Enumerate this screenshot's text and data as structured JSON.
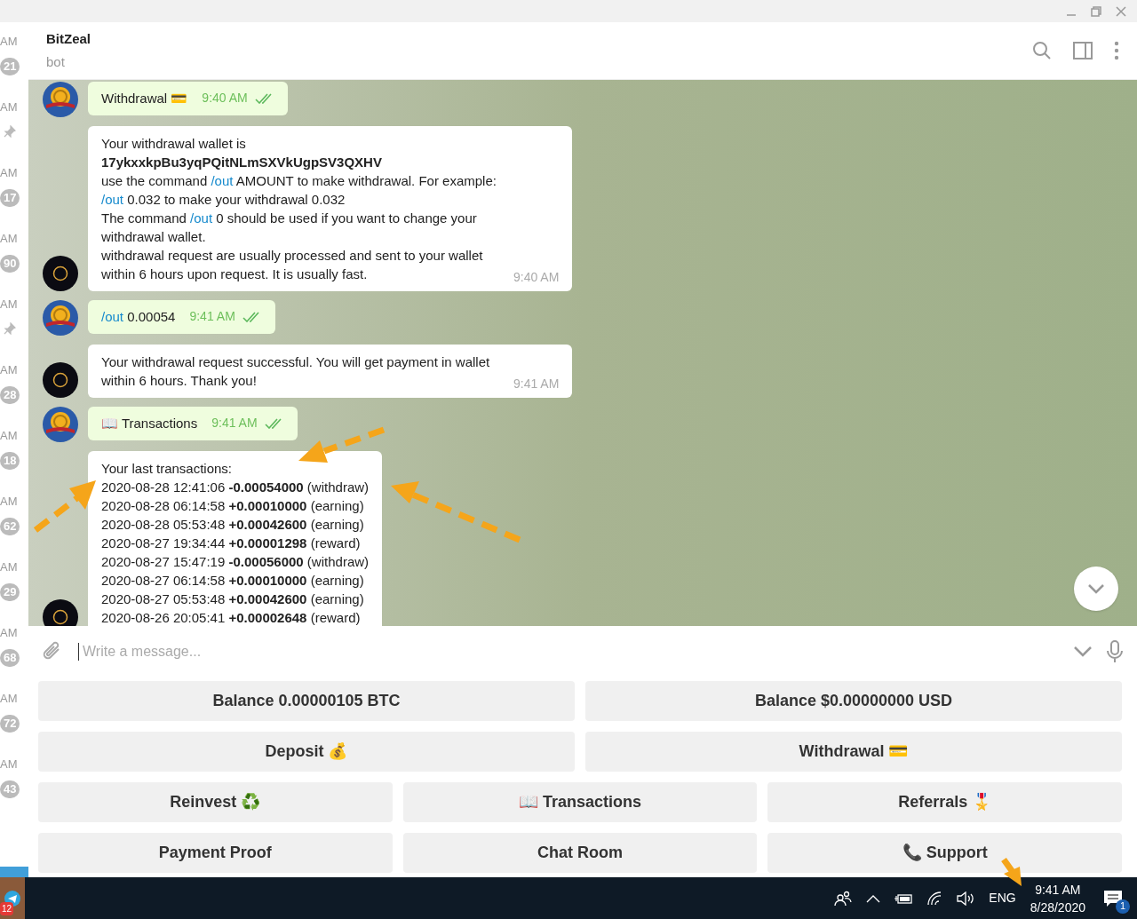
{
  "sidebar": {
    "items": [
      {
        "time": "AM",
        "badge": "21",
        "pinned": false
      },
      {
        "time": "AM",
        "pinned": true
      },
      {
        "time": "AM",
        "badge": "17",
        "pinned": false
      },
      {
        "time": "AM",
        "badge": "90",
        "pinned": false
      },
      {
        "time": "AM",
        "pinned": true
      },
      {
        "time": "AM",
        "badge": "28",
        "pinned": false
      },
      {
        "time": "AM",
        "badge": "18",
        "pinned": false
      },
      {
        "time": "AM",
        "badge": "62",
        "pinned": false
      },
      {
        "time": "AM",
        "badge": "29",
        "pinned": false
      },
      {
        "time": "AM",
        "badge": "68",
        "pinned": false
      },
      {
        "time": "AM",
        "badge": "72",
        "pinned": false
      },
      {
        "time": "AM",
        "badge": "43",
        "pinned": false
      }
    ]
  },
  "header": {
    "title": "BitZeal",
    "subtitle": "bot"
  },
  "messages": [
    {
      "kind": "outgoing",
      "time": "9:40 AM",
      "read": true,
      "lines": [
        [
          {
            "kind": "text",
            "t": "Withdrawal 💳"
          }
        ]
      ]
    },
    {
      "kind": "incoming",
      "time": "9:40 AM",
      "lines": [
        [
          {
            "kind": "text",
            "t": "Your withdrawal wallet is"
          }
        ],
        [
          {
            "kind": "bold",
            "t": "17ykxxkpBu3yqPQitNLmSXVkUgpSV3QXHV"
          }
        ],
        [
          {
            "kind": "text",
            "t": "use the command "
          },
          {
            "kind": "command",
            "t": "/out"
          },
          {
            "kind": "text",
            "t": " AMOUNT to make withdrawal. For example:"
          }
        ],
        [
          {
            "kind": "command",
            "t": "/out"
          },
          {
            "kind": "text",
            "t": " 0.032 to make your withdrawal 0.032"
          }
        ],
        [
          {
            "kind": "text",
            "t": "The command "
          },
          {
            "kind": "command",
            "t": "/out"
          },
          {
            "kind": "text",
            "t": " 0 should be used if you want to change your withdrawal wallet."
          }
        ],
        [
          {
            "kind": "text",
            "t": "withdrawal request are usually processed and sent to your wallet within 6 hours upon request. It is usually fast."
          }
        ]
      ]
    },
    {
      "kind": "outgoing",
      "time": "9:41 AM",
      "read": true,
      "lines": [
        [
          {
            "kind": "command",
            "t": "/out"
          },
          {
            "kind": "text",
            "t": " 0.00054"
          }
        ]
      ]
    },
    {
      "kind": "incoming",
      "time": "9:41 AM",
      "lines": [
        [
          {
            "kind": "text",
            "t": "Your withdrawal request successful. You will get payment in wallet within 6 hours. Thank you!"
          }
        ]
      ]
    },
    {
      "kind": "outgoing",
      "time": "9:41 AM",
      "read": true,
      "lines": [
        [
          {
            "kind": "text",
            "t": "📖 Transactions"
          }
        ]
      ]
    },
    {
      "kind": "incoming",
      "lines": [
        [
          {
            "kind": "text",
            "t": "Your last transactions:"
          }
        ],
        [
          {
            "kind": "text",
            "t": "2020-08-28 12:41:06 "
          },
          {
            "kind": "bold",
            "t": "-0.00054000"
          },
          {
            "kind": "text",
            "t": " (withdraw)"
          }
        ],
        [
          {
            "kind": "text",
            "t": "2020-08-28 06:14:58 "
          },
          {
            "kind": "bold",
            "t": "+0.00010000"
          },
          {
            "kind": "text",
            "t": " (earning)"
          }
        ],
        [
          {
            "kind": "text",
            "t": "2020-08-28 05:53:48 "
          },
          {
            "kind": "bold",
            "t": "+0.00042600"
          },
          {
            "kind": "text",
            "t": " (earning)"
          }
        ],
        [
          {
            "kind": "text",
            "t": "2020-08-27 19:34:44 "
          },
          {
            "kind": "bold",
            "t": "+0.00001298"
          },
          {
            "kind": "text",
            "t": " (reward)"
          }
        ],
        [
          {
            "kind": "text",
            "t": "2020-08-27 15:47:19 "
          },
          {
            "kind": "bold",
            "t": "-0.00056000"
          },
          {
            "kind": "text",
            "t": " (withdraw)"
          }
        ],
        [
          {
            "kind": "text",
            "t": "2020-08-27 06:14:58 "
          },
          {
            "kind": "bold",
            "t": "+0.00010000"
          },
          {
            "kind": "text",
            "t": " (earning)"
          }
        ],
        [
          {
            "kind": "text",
            "t": "2020-08-27 05:53:48 "
          },
          {
            "kind": "bold",
            "t": "+0.00042600"
          },
          {
            "kind": "text",
            "t": " (earning)"
          }
        ],
        [
          {
            "kind": "text",
            "t": "2020-08-26 20:05:41 "
          },
          {
            "kind": "bold",
            "t": "+0.00002648"
          },
          {
            "kind": "text",
            "t": " (reward)"
          }
        ]
      ]
    }
  ],
  "composer": {
    "placeholder": "Write a message..."
  },
  "keyboard": [
    [
      "Balance 0.00000105 BTC",
      "Balance $0.00000000 USD"
    ],
    [
      "Deposit 💰",
      "Withdrawal 💳"
    ],
    [
      "Reinvest ♻️",
      "📖 Transactions",
      "Referrals 🎖️"
    ],
    [
      "Payment Proof",
      "Chat Room",
      "📞 Support"
    ]
  ],
  "taskbar": {
    "app_badge": "12",
    "language": "ENG",
    "time": "9:41 AM",
    "date": "8/28/2020",
    "notifications": "1"
  }
}
